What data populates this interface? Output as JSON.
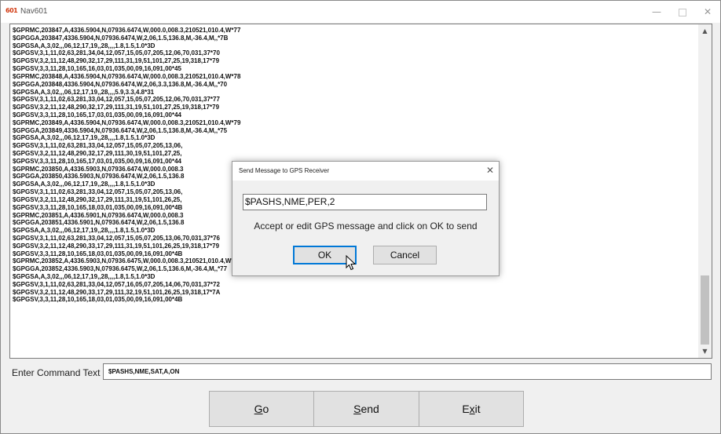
{
  "window": {
    "icon_text": "601",
    "title": "Nav601",
    "minimize_glyph": "—",
    "close_glyph": "✕"
  },
  "log": {
    "lines": [
      "$GPRMC,203847,A,4336.5904,N,07936.6474,W,000.0,008.3,210521,010.4,W*77",
      "$GPGGA,203847,4336.5904,N,07936.6474,W,2,06,1.5,136.8,M,-36.4,M,,*7B",
      "$GPGSA,A,3,02,,,06,12,17,19,,28,,,,1.8,1.5,1.0*3D",
      "$GPGSV,3,1,11,02,63,281,34,04,12,057,15,05,07,205,12,06,70,031,37*70",
      "$GPGSV,3,2,11,12,48,290,32,17,29,111,31,19,51,101,27,25,19,318,17*79",
      "$GPGSV,3,3,11,28,10,165,16,03,01,035,00,09,16,091,00*45",
      "$GPRMC,203848,A,4336.5904,N,07936.6474,W,000.0,008.3,210521,010.4,W*78",
      "$GPGGA,203848,4336.5904,N,07936.6474,W,2,06,3.3,136.8,M,-36.4,M,,*70",
      "$GPGSA,A,3,02,,,06,12,17,19,,28,,,,5.9,3.3,4.8*31",
      "$GPGSV,3,1,11,02,63,281,33,04,12,057,15,05,07,205,12,06,70,031,37*77",
      "$GPGSV,3,2,11,12,48,290,32,17,29,111,31,19,51,101,27,25,19,318,17*79",
      "$GPGSV,3,3,11,28,10,165,17,03,01,035,00,09,16,091,00*44",
      "$GPRMC,203849,A,4336.5904,N,07936.6474,W,000.0,008.3,210521,010.4,W*79",
      "$GPGGA,203849,4336.5904,N,07936.6474,W,2,06,1.5,136.8,M,-36.4,M,,*75",
      "$GPGSA,A,3,02,,,06,12,17,19,,28,,,,1.8,1.5,1.0*3D",
      "$GPGSV,3,1,11,02,63,281,33,04,12,057,15,05,07,205,13,06,",
      "$GPGSV,3,2,11,12,48,290,32,17,29,111,30,19,51,101,27,25,",
      "$GPGSV,3,3,11,28,10,165,17,03,01,035,00,09,16,091,00*44",
      "$GPRMC,203850,A,4336.5903,N,07936.6474,W,000.0,008.3",
      "$GPGGA,203850,4336.5903,N,07936.6474,W,2,06,1.5,136.8",
      "$GPGSA,A,3,02,,,06,12,17,19,,28,,,,1.8,1.5,1.0*3D",
      "$GPGSV,3,1,11,02,63,281,33,04,12,057,15,05,07,205,13,06,",
      "$GPGSV,3,2,11,12,48,290,32,17,29,111,31,19,51,101,26,25,",
      "$GPGSV,3,3,11,28,10,165,18,03,01,035,00,09,16,091,00*4B",
      "$GPRMC,203851,A,4336.5901,N,07936.6474,W,000.0,008.3",
      "$GPGGA,203851,4336.5901,N,07936.6474,W,2,06,1.5,136.8",
      "$GPGSA,A,3,02,,,06,12,17,19,,28,,,,1.8,1.5,1.0*3D",
      "$GPGSV,3,1,11,02,63,281,33,04,12,057,15,05,07,205,13,06,70,031,37*76",
      "$GPGSV,3,2,11,12,48,290,33,17,29,111,31,19,51,101,26,25,19,318,17*79",
      "$GPGSV,3,3,11,28,10,165,18,03,01,035,00,09,16,091,00*4B",
      "$GPRMC,203852,A,4336.5903,N,07936.6475,W,000.0,008.3,210521,010.4,W*75",
      "$GPGGA,203852,4336.5903,N,07936.6475,W,2,06,1.5,136.6,M,-36.4,M,,*77",
      "$GPGSA,A,3,02,,,06,12,17,19,,28,,,,1.8,1.5,1.0*3D",
      "$GPGSV,3,1,11,02,63,281,33,04,12,057,16,05,07,205,14,06,70,031,37*72",
      "$GPGSV,3,2,11,12,48,290,33,17,29,111,32,19,51,101,26,25,19,318,17*7A",
      "$GPGSV,3,3,11,28,10,165,18,03,01,035,00,09,16,091,00*4B"
    ],
    "scroll_up_glyph": "▲",
    "scroll_down_glyph": "▼"
  },
  "command": {
    "label": "Enter Command Text",
    "value": "$PASHS,NME,SAT,A,ON"
  },
  "buttons": {
    "go_mnemonic": "G",
    "go_rest": "o",
    "send_mnemonic": "S",
    "send_rest": "end",
    "exit_first": "E",
    "exit_mnemonic": "x",
    "exit_rest": "it"
  },
  "dialog": {
    "title": "Send Message to GPS Receiver",
    "close_glyph": "✕",
    "input_value": "$PASHS,NME,PER,2",
    "message": "Accept or edit GPS message and click on OK to send",
    "ok_label": "OK",
    "cancel_label": "Cancel"
  }
}
